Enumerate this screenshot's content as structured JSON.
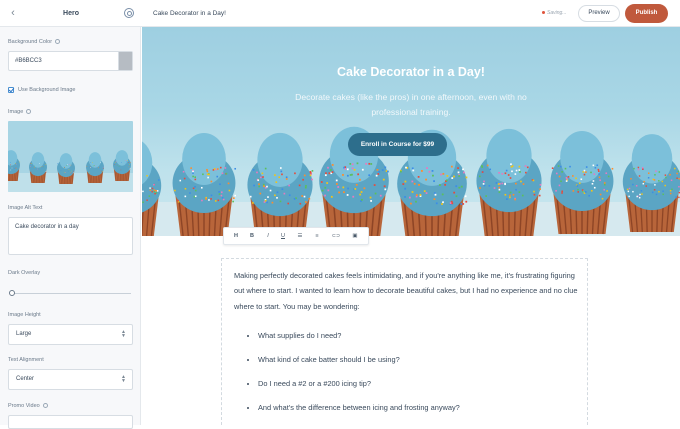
{
  "topbar": {
    "panel_title": "Hero",
    "page_title": "Cake Decorator in a Day!",
    "saving_text": "Saving...",
    "preview_label": "Preview",
    "publish_label": "Publish"
  },
  "sidebar": {
    "background_color_label": "Background Color",
    "background_color_value": "#B6BCC3",
    "use_background_image_label": "Use Background Image",
    "use_background_image_checked": true,
    "image_label": "Image",
    "image_alt_label": "Image Alt Text",
    "image_alt_value": "Cake decorator in a day",
    "dark_overlay_label": "Dark Overlay",
    "dark_overlay_value": 0,
    "image_height_label": "Image Height",
    "image_height_value": "Large",
    "text_alignment_label": "Text Alignment",
    "text_alignment_value": "Center",
    "promo_video_label": "Promo Video"
  },
  "hero": {
    "title": "Cake Decorator in a Day!",
    "subtitle": "Decorate cakes (like the pros) in one afternoon, even with no professional training.",
    "button_label": "Enroll in Course for $99"
  },
  "toolbar": {
    "buttons": [
      "H",
      "B",
      "I",
      "U",
      "☰",
      "≡",
      "⊂⊃",
      "▣"
    ]
  },
  "content": {
    "paragraph": "Making perfectly decorated cakes feels intimidating, and if you're anything like me, it's frustrating figuring out where to start. I wanted to learn how to decorate beautiful cakes, but I had no experience and no clue where to start. You may be wondering:",
    "bullets": [
      "What supplies do I need?",
      "What kind of cake batter should I be using?",
      "Do I need a #2 or a #200 icing tip?",
      "And what's the difference between icing and frosting anyway?"
    ]
  },
  "colors": {
    "accent": "#c0593c",
    "hero_button": "#2d6e8c",
    "hero_sky": "#a9d7e6"
  }
}
